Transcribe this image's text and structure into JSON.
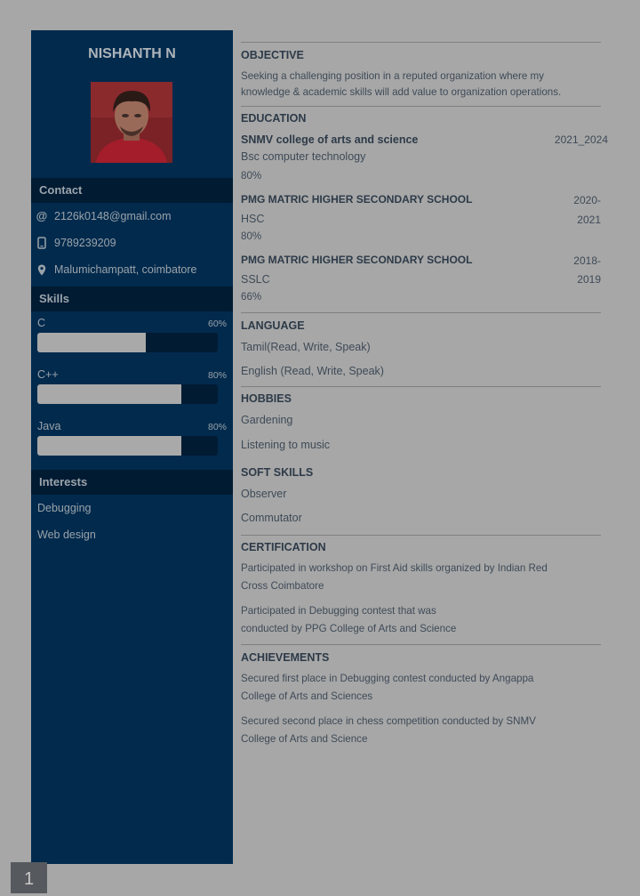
{
  "name": "NISHANTH N",
  "contact": {
    "header": "Contact",
    "email": "2126k0148@gmail.com",
    "phone": "9789239209",
    "location": "Malumichampatt, coimbatore"
  },
  "skills": {
    "header": "Skills",
    "items": [
      {
        "name": "C",
        "percent_label": "60%",
        "level": 0.6
      },
      {
        "name": "C++",
        "percent_label": "80%",
        "level": 0.8
      },
      {
        "name": "Java",
        "percent_label": "80%",
        "level": 0.8
      }
    ]
  },
  "interests": {
    "header": "Interests",
    "items": [
      "Debugging",
      "Web design"
    ]
  },
  "objective": {
    "title": "OBJECTIVE",
    "line1": "Seeking a challenging position in a reputed organization where my",
    "line2": "knowledge & academic skills will add value to organization operations."
  },
  "education": {
    "title": "EDUCATION",
    "entries": [
      {
        "school": "SNMV college of arts and science",
        "course": "Bsc computer technology",
        "score": "80%",
        "year_a": "2021_2024",
        "year_b": ""
      },
      {
        "school": "PMG MATRIC HIGHER SECONDARY SCHOOL",
        "course": "HSC",
        "score": "80%",
        "year_a": "2020-",
        "year_b": "2021"
      },
      {
        "school": "PMG MATRIC HIGHER SECONDARY SCHOOL",
        "course": "SSLC",
        "score": "66%",
        "year_a": "2018-",
        "year_b": "2019"
      }
    ]
  },
  "language": {
    "title": "LANGUAGE",
    "items": [
      "Tamil(Read, Write, Speak)",
      "English (Read, Write, Speak)"
    ]
  },
  "hobbies": {
    "title": "HOBBIES",
    "items": [
      "Gardening",
      "Listening to music"
    ]
  },
  "soft_skills": {
    "title": "SOFT SKILLS",
    "items": [
      "Observer",
      "Commutator"
    ]
  },
  "certification": {
    "title": "CERTIFICATION",
    "items": [
      {
        "line1": "Participated in workshop on First Aid skills organized by Indian Red",
        "line2": "Cross Coimbatore"
      },
      {
        "line1": "Participated in Debugging contest that was",
        "line2": "conducted by PPG College of Arts and Science"
      }
    ]
  },
  "achievements": {
    "title": "ACHIEVEMENTS",
    "items": [
      {
        "line1": "Secured first place in Debugging contest conducted by Angappa",
        "line2": "College of Arts and Sciences"
      },
      {
        "line1": "Secured second place in chess competition conducted by SNMV",
        "line2": "College of Arts and Science"
      }
    ]
  },
  "page_number": "1"
}
